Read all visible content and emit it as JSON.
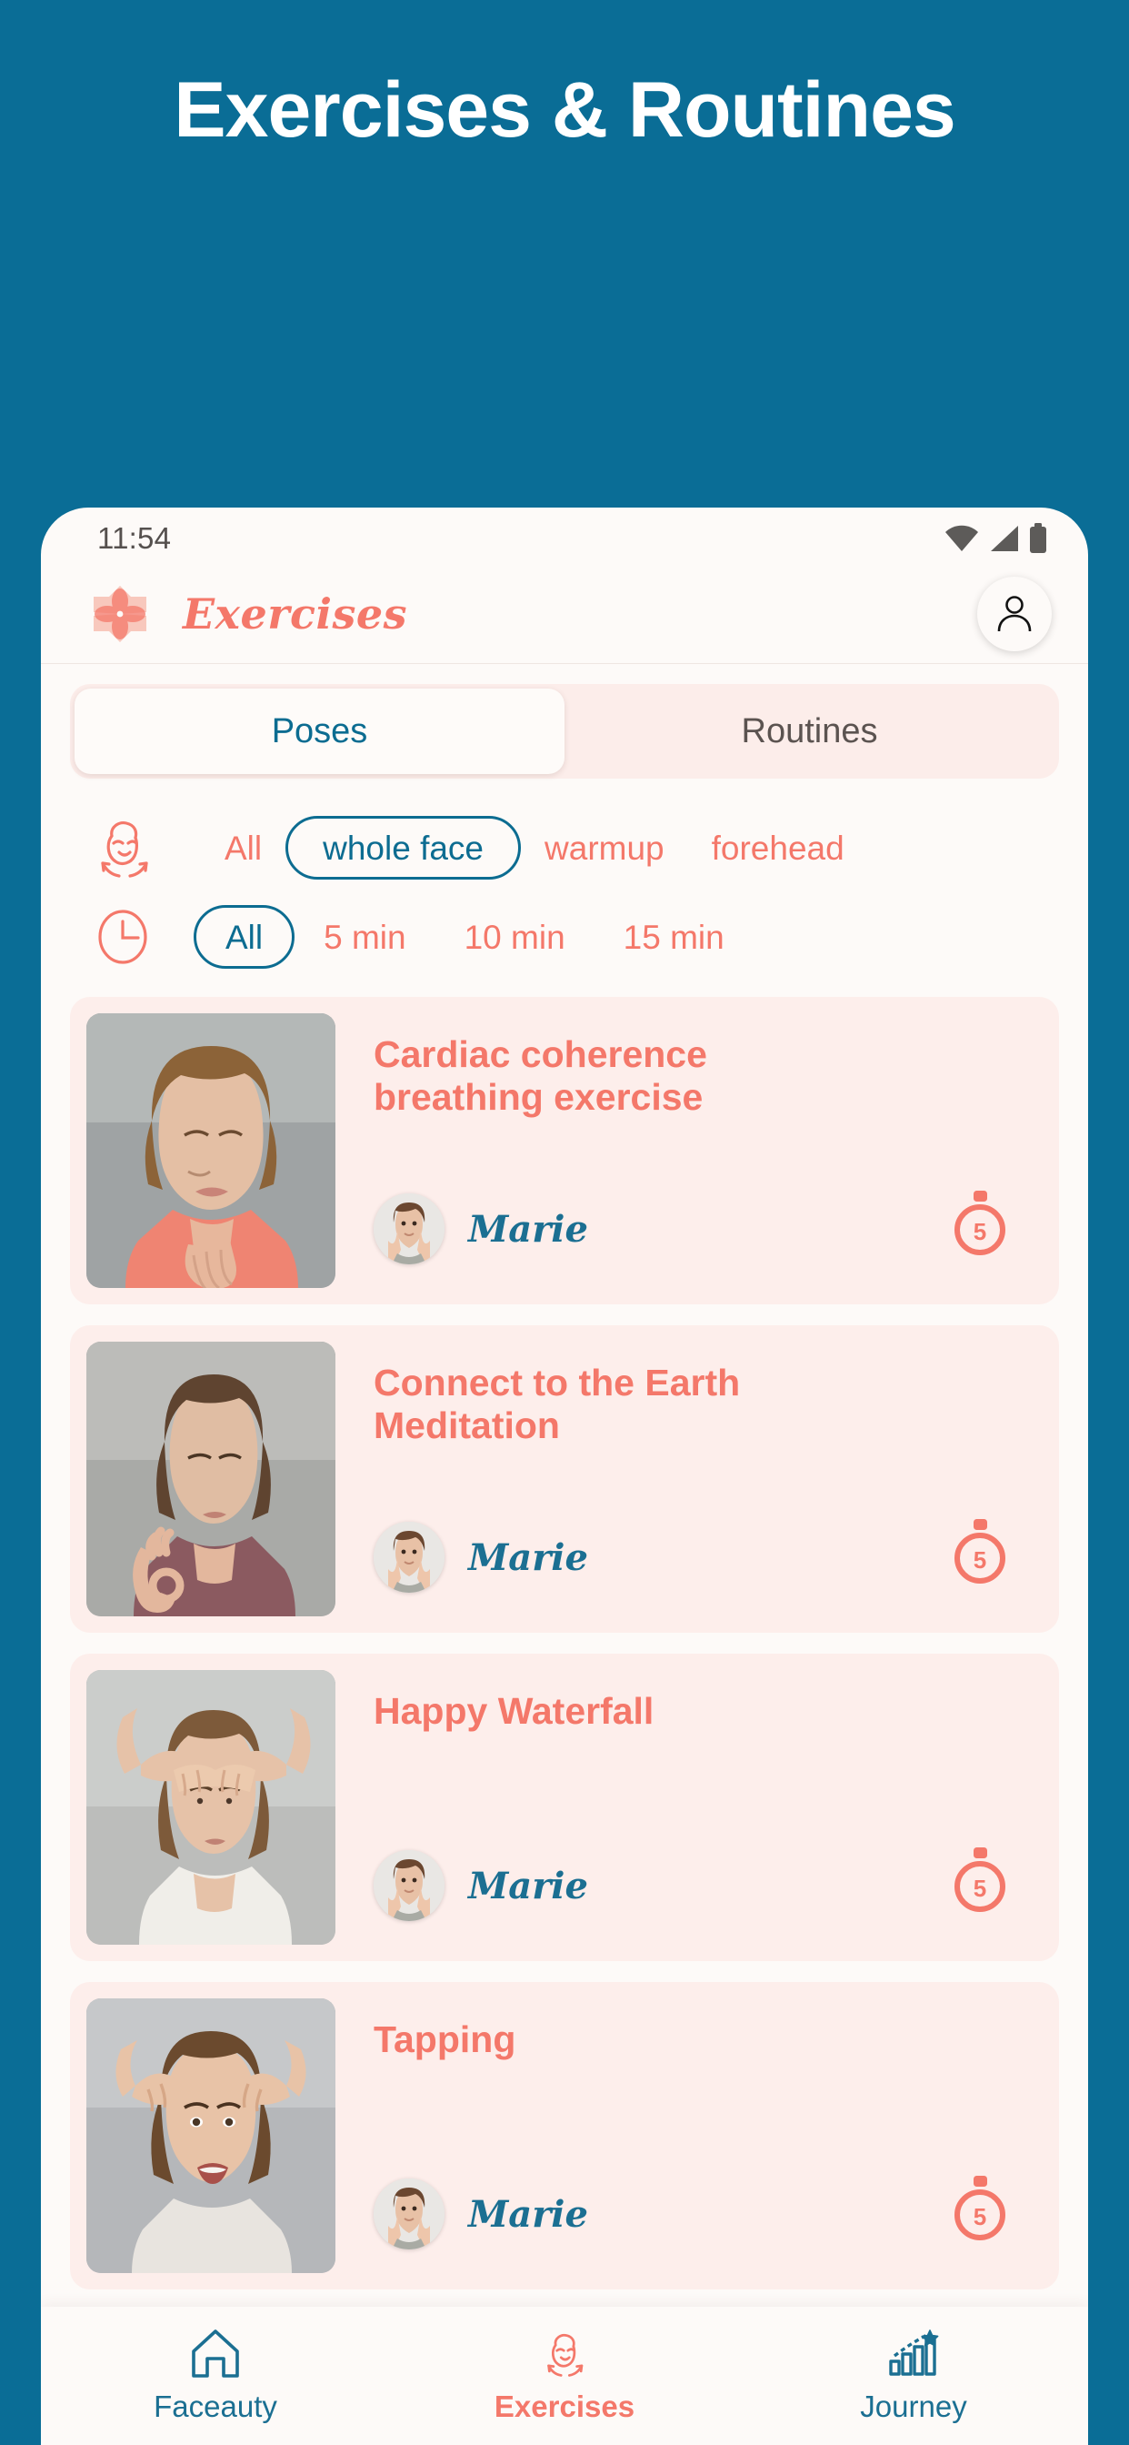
{
  "promo": {
    "headline": "Exercises & Routines",
    "background_color": "#0a6d96"
  },
  "statusbar": {
    "time": "11:54",
    "icons": [
      "wifi-icon",
      "cellular-signal-icon",
      "battery-icon"
    ]
  },
  "appbar": {
    "logo": "lotus-flower-logo",
    "title": "Exercises",
    "profile_button": "person-icon"
  },
  "tabs": {
    "items": [
      {
        "label": "Poses",
        "active": true
      },
      {
        "label": "Routines",
        "active": false
      }
    ]
  },
  "filters": {
    "body_area": {
      "icon": "face-massage-icon",
      "chips": [
        {
          "label": "All",
          "selected": false
        },
        {
          "label": "whole face",
          "selected": true
        },
        {
          "label": "warmup",
          "selected": false
        },
        {
          "label": "forehead",
          "selected": false
        }
      ]
    },
    "duration": {
      "icon": "clock-icon",
      "chips": [
        {
          "label": "All",
          "selected": true
        },
        {
          "label": "5 min",
          "selected": false
        },
        {
          "label": "10 min",
          "selected": false
        },
        {
          "label": "15 min",
          "selected": false
        }
      ]
    }
  },
  "exercises": [
    {
      "title": "Cardiac coherence breathing exercise",
      "author": "Marie",
      "duration": "5",
      "thumb": "woman-hands-on-chest-breathing",
      "thumb_bg": "#9fa3a4",
      "top_color": "#c9ccca",
      "shirt_color": "#ef8472",
      "hair_color": "#8c6338"
    },
    {
      "title": "Connect to the Earth Meditation",
      "author": "Marie",
      "duration": "5",
      "thumb": "woman-meditating-mudra",
      "thumb_bg": "#a9aaa7",
      "top_color": "#babab6",
      "shirt_color": "#8b5a60",
      "hair_color": "#5f4430"
    },
    {
      "title": "Happy Waterfall",
      "author": "Marie",
      "duration": "5",
      "thumb": "woman-hands-on-forehead",
      "thumb_bg": "#bcbdbb",
      "top_color": "#cfd0ce",
      "shirt_color": "#f0eee9",
      "hair_color": "#7d5a3a"
    },
    {
      "title": "Tapping",
      "author": "Marie",
      "duration": "5",
      "thumb": "woman-tapping-temples",
      "thumb_bg": "#b5b7ba",
      "top_color": "#c6c8ca",
      "shirt_color": "#e8e4df",
      "hair_color": "#6b4a2e"
    }
  ],
  "bottomnav": {
    "items": [
      {
        "label": "Faceauty",
        "icon": "home-icon",
        "active": false
      },
      {
        "label": "Exercises",
        "icon": "face-massage-icon",
        "active": true
      },
      {
        "label": "Journey",
        "icon": "bar-chart-star-icon",
        "active": false
      }
    ]
  },
  "colors": {
    "brand_teal": "#0c6c91",
    "brand_coral": "#f4786a",
    "card_bg": "#fdeeeb",
    "app_bg": "#fdfaf8"
  }
}
